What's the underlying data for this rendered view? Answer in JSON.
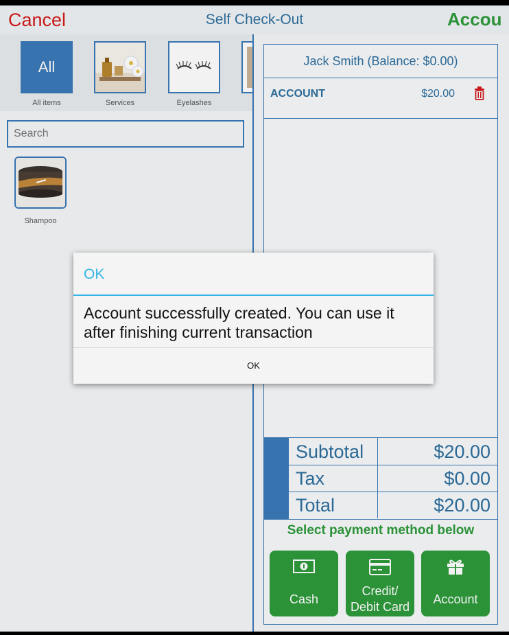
{
  "header": {
    "cancel_label": "Cancel",
    "title": "Self Check-Out",
    "account_label": "Accou"
  },
  "categories": [
    {
      "label": "All items",
      "tile_text": "All"
    },
    {
      "label": "Services"
    },
    {
      "label": "Eyelashes"
    }
  ],
  "search": {
    "placeholder": "Search"
  },
  "products": [
    {
      "label": "Shampoo"
    }
  ],
  "cart": {
    "customer": "Jack Smith (Balance: $0.00)",
    "items": [
      {
        "name": "ACCOUNT",
        "price": "$20.00"
      }
    ],
    "subtotal_label": "Subtotal",
    "subtotal": "$20.00",
    "tax_label": "Tax",
    "tax": "$0.00",
    "total_label": "Total",
    "total": "$20.00"
  },
  "payment": {
    "heading": "Select payment method below",
    "cash": "Cash",
    "card_line1": "Credit/",
    "card_line2": "Debit Card",
    "account": "Account"
  },
  "dialog": {
    "title": "OK",
    "message": "Account successfully created. You can use it after finishing current transaction",
    "ok": "OK"
  },
  "colors": {
    "brand_blue": "#3a7ab8",
    "cancel_red": "#d21b1b",
    "pay_green": "#2e9a3c",
    "dialog_accent": "#33b5e5"
  }
}
